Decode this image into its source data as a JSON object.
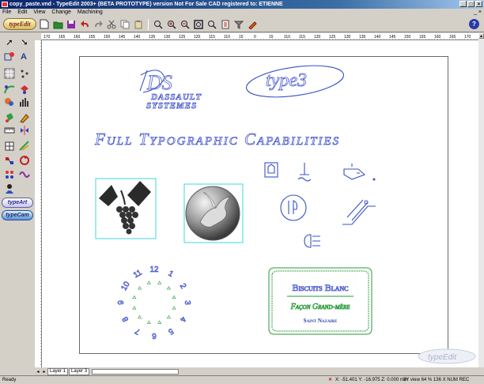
{
  "window": {
    "title": "copy_paste.vnd - TypeEdit 2003+ (BETA PROTOTYPE) version Not For Sale CAD registered to: ETIENNE",
    "buttons": [
      "_",
      "□",
      "×"
    ],
    "mdi_controls": "_ ×"
  },
  "menu": {
    "items": [
      "File",
      "Edit",
      "View",
      "Change",
      "Machining"
    ],
    "help_mark": "?"
  },
  "toolbar": {
    "logo": "typeEdit",
    "help_icon": "?"
  },
  "left_toolbar": {
    "type_art": "typeArt",
    "type_cam": "typeCam"
  },
  "ruler": {
    "h_labels": [
      "170",
      "165",
      "160",
      "155",
      "150",
      "145",
      "140",
      "135",
      "130",
      "125",
      "120",
      "115",
      "110",
      "15",
      "0",
      "15",
      "110",
      "115",
      "120",
      "125",
      "130",
      "135",
      "140",
      "145",
      "150",
      "155",
      "160",
      "165",
      "170"
    ]
  },
  "canvas": {
    "logo_letters": "DS",
    "logo_line1": "DASSAULT",
    "logo_line2": "SYSTEMES",
    "type3_logo": "type3",
    "headline": "Full Typographic Capabilities",
    "clock_numbers": [
      "12",
      "1",
      "2",
      "3",
      "4",
      "5",
      "6",
      "7",
      "8",
      "9",
      "10",
      "11"
    ],
    "label_line1": "Biscuits Blanc",
    "label_line2": "Façon Grand-mère",
    "label_line3": "Saint Nazaire",
    "watermark": "typeEdit"
  },
  "layers": {
    "tabs": [
      "Layer 1",
      "Layer 3"
    ]
  },
  "status": {
    "left": "Ready",
    "coords": "X: -51.401  Y: -16.975  Z: 0.000 mm",
    "view": "3Y view  64 %  136 X  NUM  REC"
  },
  "colors": {
    "title_gradient_start": "#0a246a",
    "outline_blue": "#5060d0",
    "selection_cyan": "#40d8d8",
    "label_green": "#2a9a3a"
  }
}
